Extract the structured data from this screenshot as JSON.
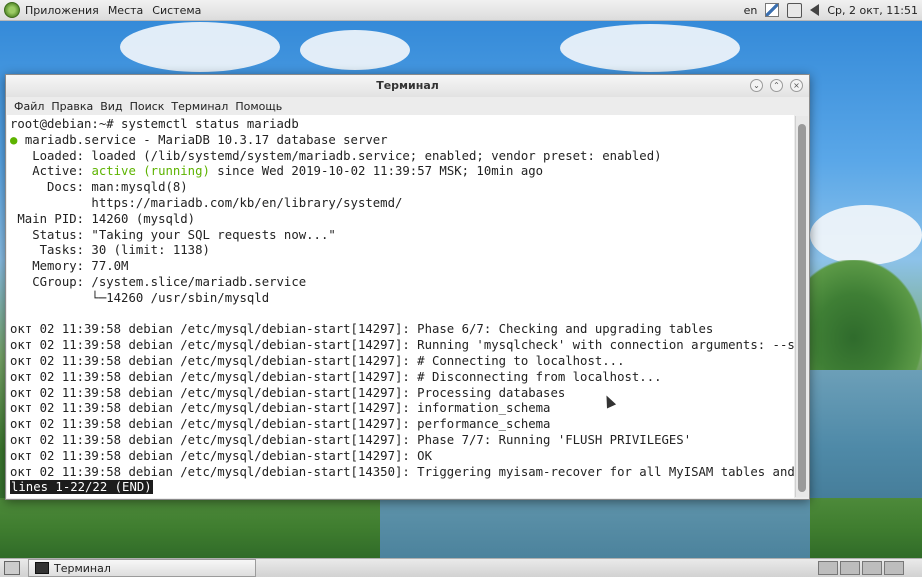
{
  "top_panel": {
    "menus": [
      "Приложения",
      "Места",
      "Система"
    ],
    "keyboard_layout": "en",
    "clock": "Ср, 2 окт, 11:51"
  },
  "window": {
    "title": "Терминал",
    "menu": [
      "Файл",
      "Правка",
      "Вид",
      "Поиск",
      "Терминал",
      "Помощь"
    ],
    "controls": [
      "minimize",
      "maximize",
      "close"
    ]
  },
  "terminal": {
    "prompt": "root@debian:~# systemctl status mariadb",
    "service_line": "mariadb.service - MariaDB 10.3.17 database server",
    "loaded": "   Loaded: loaded (/lib/systemd/system/mariadb.service; enabled; vendor preset: enabled)",
    "active_label": "   Active: ",
    "active_state": "active (running)",
    "active_rest": " since Wed 2019-10-02 11:39:57 MSK; 10min ago",
    "docs1": "     Docs: man:mysqld(8)",
    "docs2": "           https://mariadb.com/kb/en/library/systemd/",
    "main_pid": " Main PID: 14260 (mysqld)",
    "status": "   Status: \"Taking your SQL requests now...\"",
    "tasks": "    Tasks: 30 (limit: 1138)",
    "memory": "   Memory: 77.0M",
    "cgroup1": "   CGroup: /system.slice/mariadb.service",
    "cgroup2": "           └─14260 /usr/sbin/mysqld",
    "log_lines": [
      "окт 02 11:39:58 debian /etc/mysql/debian-start[14297]: Phase 6/7: Checking and upgrading tables",
      "окт 02 11:39:58 debian /etc/mysql/debian-start[14297]: Running 'mysqlcheck' with connection arguments: --sock",
      "окт 02 11:39:58 debian /etc/mysql/debian-start[14297]: # Connecting to localhost...",
      "окт 02 11:39:58 debian /etc/mysql/debian-start[14297]: # Disconnecting from localhost...",
      "окт 02 11:39:58 debian /etc/mysql/debian-start[14297]: Processing databases",
      "окт 02 11:39:58 debian /etc/mysql/debian-start[14297]: information_schema",
      "окт 02 11:39:58 debian /etc/mysql/debian-start[14297]: performance_schema",
      "окт 02 11:39:58 debian /etc/mysql/debian-start[14297]: Phase 7/7: Running 'FLUSH PRIVILEGES'",
      "окт 02 11:39:58 debian /etc/mysql/debian-start[14297]: OK",
      "окт 02 11:39:58 debian /etc/mysql/debian-start[14350]: Triggering myisam-recover for all MyISAM tables and ar"
    ],
    "pager_status": "lines 1-22/22 (END)"
  },
  "bottom_panel": {
    "task": "Терминал"
  },
  "colors": {
    "active_green": "#5db300",
    "terminal_bg": "#ffffff"
  }
}
